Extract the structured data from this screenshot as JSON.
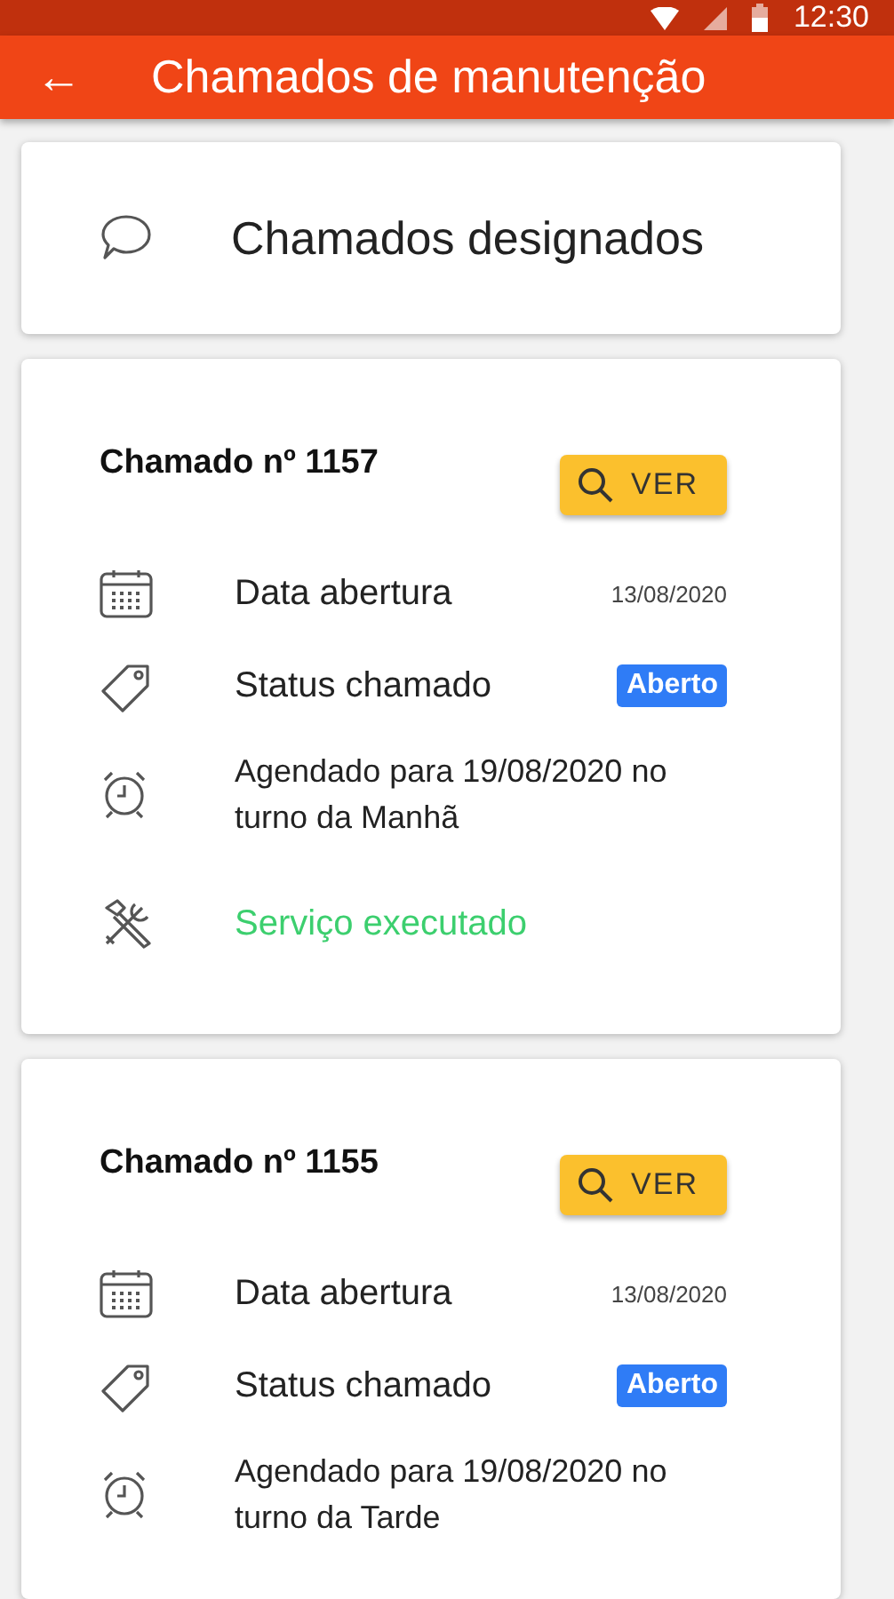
{
  "status_bar": {
    "time": "12:30"
  },
  "app_bar": {
    "back": "←",
    "title": "Chamados de manutenção"
  },
  "header_card": {
    "title": "Chamados designados"
  },
  "tickets": [
    {
      "title": "Chamado nº 1157",
      "button": "VER",
      "rows": [
        {
          "kind": "date",
          "label": "Data abertura",
          "value": "13/08/2020"
        },
        {
          "kind": "status",
          "label": "Status chamado",
          "value": "Aberto"
        },
        {
          "kind": "schedule",
          "label": "Agendado para 19/08/2020 no turno da Manhã"
        },
        {
          "kind": "service",
          "label": "Serviço executado"
        }
      ]
    },
    {
      "title": "Chamado nº 1155",
      "button": "VER",
      "rows": [
        {
          "kind": "date",
          "label": "Data abertura",
          "value": "13/08/2020"
        },
        {
          "kind": "status",
          "label": "Status chamado",
          "value": "Aberto"
        },
        {
          "kind": "schedule",
          "label": "Agendado para 19/08/2020 no turno da Tarde"
        }
      ]
    }
  ]
}
